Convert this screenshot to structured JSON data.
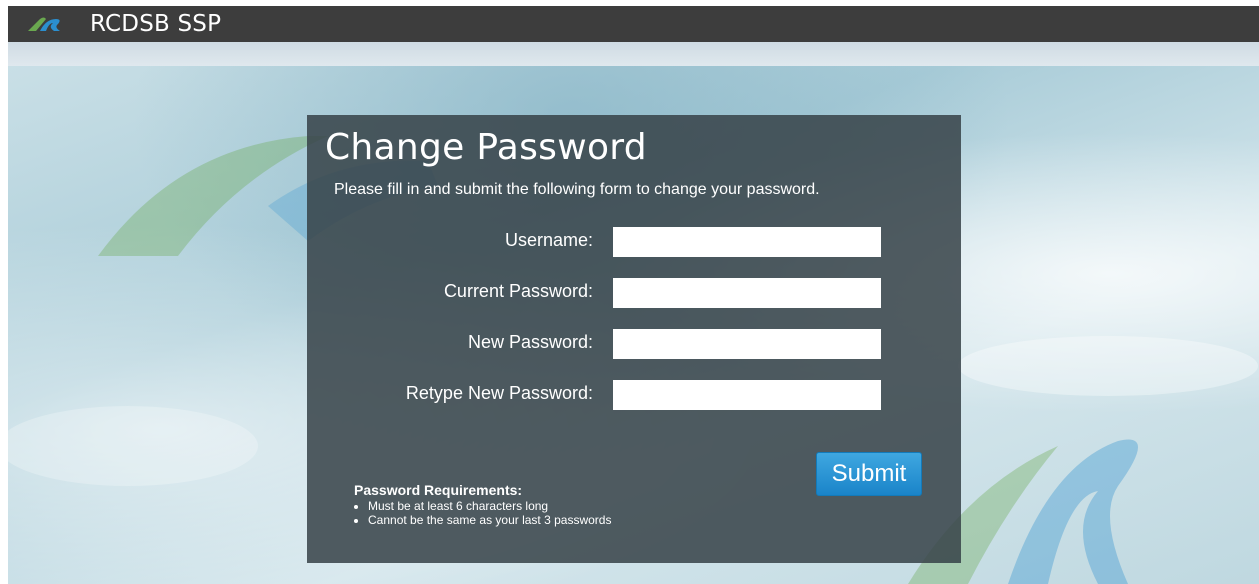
{
  "header": {
    "app_title": "RCDSB SSP",
    "logo_icon": "rcdsb-logo-icon"
  },
  "form": {
    "title": "Change Password",
    "intro": "Please fill in and submit the following form to change your password.",
    "fields": [
      {
        "label": "Username:",
        "value": "",
        "placeholder": ""
      },
      {
        "label": "Current Password:",
        "value": "",
        "placeholder": ""
      },
      {
        "label": "New Password:",
        "value": "",
        "placeholder": ""
      },
      {
        "label": "Retype New Password:",
        "value": "",
        "placeholder": ""
      }
    ],
    "submit_label": "Submit"
  },
  "requirements": {
    "title": "Password Requirements:",
    "items": [
      "Must be at least 6 characters long",
      "Cannot be the same as your last 3 passwords"
    ]
  },
  "colors": {
    "header_bg": "#3d3d3d",
    "panel_bg": "#374248",
    "submit_bg": "#2a95d6",
    "logo_green": "#6aa84f",
    "logo_blue": "#2b8fcf"
  }
}
